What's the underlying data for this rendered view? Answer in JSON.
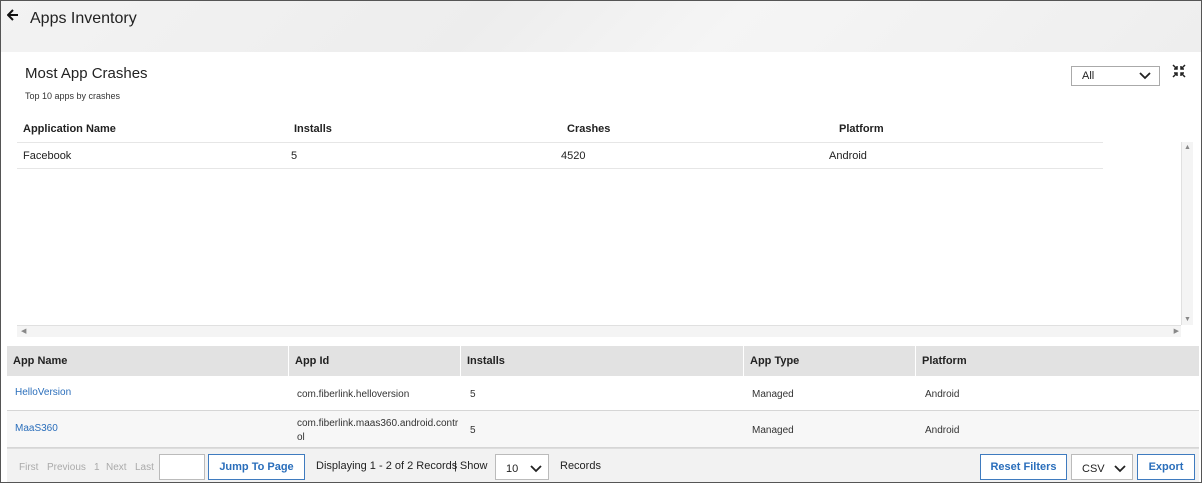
{
  "header": {
    "title": "Apps Inventory"
  },
  "widget": {
    "title": "Most App Crashes",
    "subtitle": "Top 10 apps by crashes",
    "filter_value": "All",
    "columns": [
      "Application Name",
      "Installs",
      "Crashes",
      "Platform"
    ],
    "rows": [
      {
        "name": "Facebook",
        "installs": "5",
        "crashes": "4520",
        "platform": "Android"
      }
    ]
  },
  "grid": {
    "columns": [
      "App Name",
      "App Id",
      "Installs",
      "App Type",
      "Platform"
    ],
    "rows": [
      {
        "name": "HelloVersion",
        "id": "com.fiberlink.helloversion",
        "installs": "5",
        "type": "Managed",
        "platform": "Android"
      },
      {
        "name": "MaaS360",
        "id": "com.fiberlink.maas360.android.contr ol",
        "installs": "5",
        "type": "Managed",
        "platform": "Android"
      }
    ]
  },
  "pager": {
    "first": "First",
    "previous": "Previous",
    "page": "1",
    "next": "Next",
    "last": "Last",
    "jump_label": "Jump To Page",
    "displaying": "Displaying 1 - 2 of 2 Records",
    "show": "| Show",
    "page_size": "10",
    "records": "Records",
    "reset_label": "Reset Filters",
    "format": "CSV",
    "export_label": "Export"
  }
}
